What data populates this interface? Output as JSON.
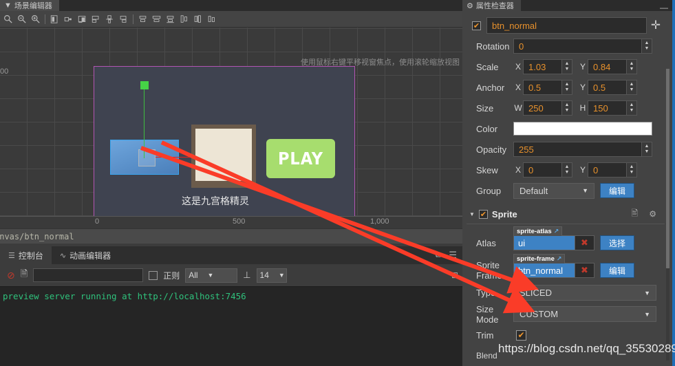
{
  "scene_panel": {
    "tab_label": "场景编辑器",
    "tab_icon": "scene-icon",
    "toolbar_icons": [
      "pan-icon",
      "zoom-out-icon",
      "zoom-in-icon",
      "align-left-icon",
      "align-h-center-icon",
      "align-right-icon",
      "align-top-icon",
      "align-v-center-icon",
      "align-bottom-icon",
      "dist-left-icon",
      "dist-h-center-icon",
      "dist-right-icon",
      "dist-top-icon",
      "dist-v-center-icon",
      "dist-bottom-icon"
    ],
    "hint": "使用鼠标右键平移视窗焦点，使用滚轮缩放视图",
    "vruler_label": "00",
    "hruler_labels": [
      "0",
      "500",
      "1,000"
    ],
    "nodes": {
      "blue_label": "",
      "nine_patch_caption": "这是九宫格精灵",
      "play_button_label": "PLAY"
    },
    "path": "anvas/btn_normal"
  },
  "console": {
    "tabs": [
      {
        "label": "控制台",
        "icon": "console-icon",
        "active": true
      },
      {
        "label": "动画编辑器",
        "icon": "animation-icon",
        "active": false
      }
    ],
    "clear_icon": "clear-icon",
    "file_icon": "file-icon",
    "search_value": "",
    "search_placeholder": "",
    "regex_label": "正则",
    "level_value": "All",
    "font_icon": "font-size-icon",
    "font_size_value": "14",
    "popout_icon": "popout-icon",
    "menu_icon": "hamburger-icon",
    "dock_icon": "dock-icon",
    "output_lines": [
      "preview server running at http://localhost:7456"
    ]
  },
  "inspector": {
    "tab_label": "属性检查器",
    "tab_icon": "inspector-icon",
    "minimize_icon": "minimize-icon",
    "node_name": "btn_normal",
    "node_enabled_icon": "check-icon",
    "add_component_icon": "plus-icon",
    "props": [
      {
        "label": "Rotation",
        "value": "0",
        "kind": "wide"
      },
      {
        "label": "Scale",
        "x_label": "X",
        "x": "1.03",
        "y_label": "Y",
        "y": "0.84",
        "kind": "xy"
      },
      {
        "label": "Anchor",
        "x_label": "X",
        "x": "0.5",
        "y_label": "Y",
        "y": "0.5",
        "kind": "xy"
      },
      {
        "label": "Size",
        "x_label": "W",
        "x": "250",
        "y_label": "H",
        "y": "150",
        "kind": "xy"
      },
      {
        "label": "Color",
        "value": "#FFFFFF",
        "kind": "color"
      },
      {
        "label": "Opacity",
        "value": "255",
        "kind": "wide"
      },
      {
        "label": "Skew",
        "x_label": "X",
        "x": "0",
        "y_label": "Y",
        "y": "0",
        "kind": "xy"
      }
    ],
    "group": {
      "label": "Group",
      "value": "Default",
      "button": "编辑"
    },
    "sprite_section": {
      "title": "Sprite",
      "caret_icon": "caret-down-icon",
      "enabled_icon": "check-icon",
      "help_icon": "help-icon",
      "gear_icon": "gear-icon",
      "atlas": {
        "label": "Atlas",
        "tag": "sprite-atlas",
        "tag_icon": "external-link-icon",
        "value": "ui",
        "clear_icon": "x-icon",
        "button": "选择"
      },
      "sprite_frame": {
        "label": "Sprite Frame",
        "tag": "sprite-frame",
        "tag_icon": "external-link-icon",
        "value": "btn_normal",
        "clear_icon": "x-icon",
        "button": "编辑"
      },
      "type": {
        "label": "Type",
        "value": "SLICED"
      },
      "size_mode": {
        "label": "Size Mode",
        "value": "CUSTOM"
      },
      "trim": {
        "label": "Trim",
        "checked_icon": "check-icon"
      },
      "blend": {
        "label": "Blend"
      }
    },
    "accent_blue": "#3d82c4",
    "value_orange": "#e8912c"
  },
  "watermark": "https://blog.csdn.net/qq_35530289"
}
